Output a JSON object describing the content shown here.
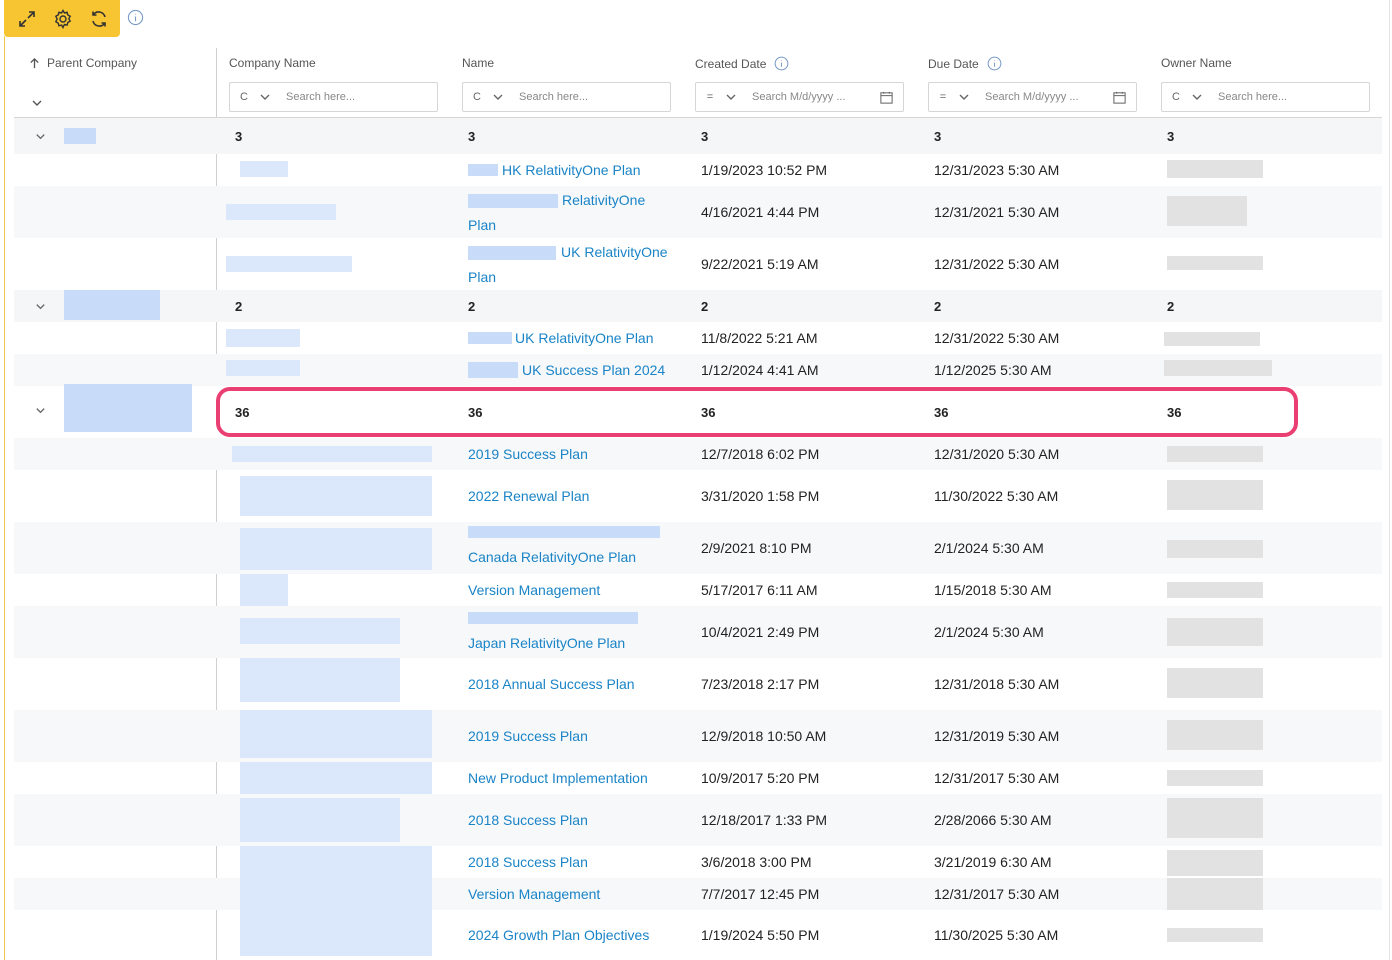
{
  "toolbar": {
    "icons": [
      "expand-icon",
      "gear-icon",
      "refresh-icon",
      "info-icon"
    ],
    "accent": "#f7c531"
  },
  "columns": {
    "parent_company": "Parent Company",
    "company_name": "Company Name",
    "name": "Name",
    "created_date": "Created Date",
    "due_date": "Due Date",
    "owner_name": "Owner Name"
  },
  "filters": {
    "company_name": {
      "op": "C",
      "placeholder": "Search here..."
    },
    "name": {
      "op": "C",
      "placeholder": "Search here..."
    },
    "created_date": {
      "op": "=",
      "placeholder": "Search M/d/yyyy ..."
    },
    "due_date": {
      "op": "=",
      "placeholder": "Search M/d/yyyy ..."
    },
    "owner_name": {
      "op": "C",
      "placeholder": "Search here..."
    }
  },
  "groups": [
    {
      "count": "3",
      "rows": [
        {
          "name": "HK RelativityOne Plan",
          "created": "1/19/2023 10:52 PM",
          "due": "12/31/2023 5:30 AM"
        },
        {
          "name": "RelativityOne Plan",
          "created": "4/16/2021 4:44 PM",
          "due": "12/31/2021 5:30 AM"
        },
        {
          "name": "UK RelativityOne Plan",
          "created": "9/22/2021 5:19 AM",
          "due": "12/31/2022 5:30 AM"
        }
      ]
    },
    {
      "count": "2",
      "rows": [
        {
          "name": "UK RelativityOne Plan",
          "created": "11/8/2022 5:21 AM",
          "due": "12/31/2022 5:30 AM"
        },
        {
          "name": "UK Success Plan 2024",
          "created": "1/12/2024 4:41 AM",
          "due": "1/12/2025 5:30 AM"
        }
      ]
    },
    {
      "count": "36",
      "rows": [
        {
          "name": "2019 Success Plan",
          "created": "12/7/2018 6:02 PM",
          "due": "12/31/2020 5:30 AM"
        },
        {
          "name": "2022 Renewal Plan",
          "created": "3/31/2020 1:58 PM",
          "due": "11/30/2022 5:30 AM"
        },
        {
          "name": "Canada RelativityOne Plan",
          "created": "2/9/2021 8:10 PM",
          "due": "2/1/2024 5:30 AM"
        },
        {
          "name": "Version Management",
          "created": "5/17/2017 6:11 AM",
          "due": "1/15/2018 5:30 AM"
        },
        {
          "name": "Japan RelativityOne Plan",
          "created": "10/4/2021 2:49 PM",
          "due": "2/1/2024 5:30 AM"
        },
        {
          "name": "2018 Annual Success Plan",
          "created": "7/23/2018 2:17 PM",
          "due": "12/31/2018 5:30 AM"
        },
        {
          "name": "2019 Success Plan",
          "created": "12/9/2018 10:50 AM",
          "due": "12/31/2019 5:30 AM"
        },
        {
          "name": "New Product Implementation",
          "created": "10/9/2017 5:20 PM",
          "due": "12/31/2017 5:30 AM"
        },
        {
          "name": "2018 Success Plan",
          "created": "12/18/2017 1:33 PM",
          "due": "2/28/2066 5:30 AM"
        },
        {
          "name": "2018 Success Plan",
          "created": "3/6/2018 3:00 PM",
          "due": "3/21/2019 6:30 AM"
        },
        {
          "name": "Version Management",
          "created": "7/7/2017 12:45 PM",
          "due": "12/31/2017 5:30 AM"
        },
        {
          "name": "2024 Growth Plan Objectives",
          "created": "1/19/2024 5:50 PM",
          "due": "11/30/2025 5:30 AM"
        }
      ]
    }
  ],
  "highlight_color": "#ea3f72",
  "link_color": "#1a84c7"
}
